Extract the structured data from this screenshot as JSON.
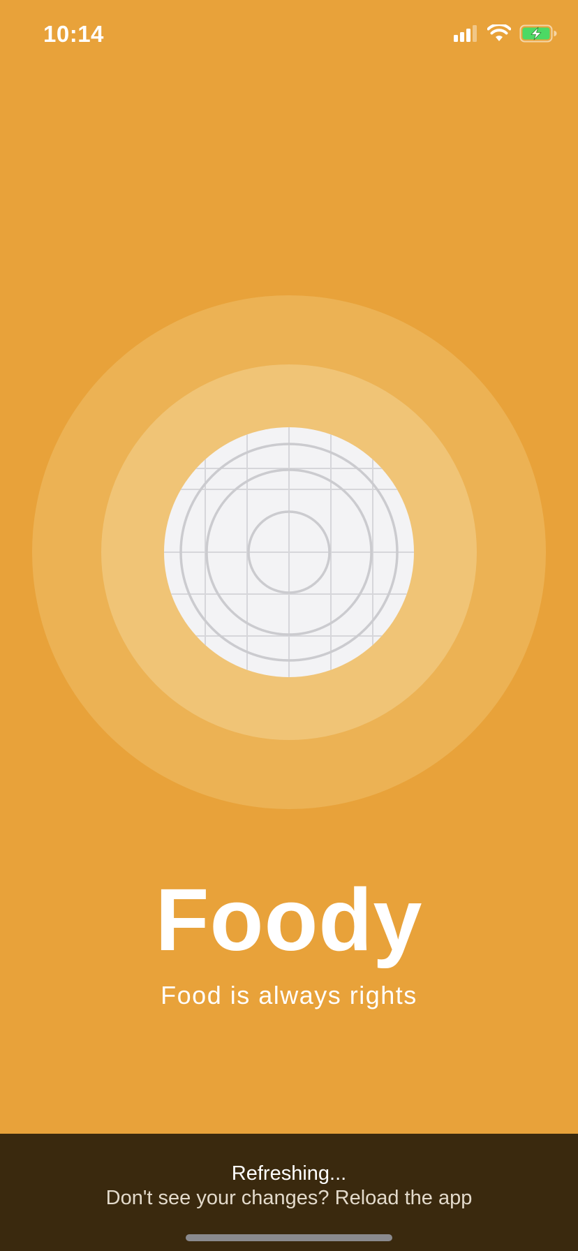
{
  "status_bar": {
    "time": "10:14",
    "icons": [
      "cellular-signal-icon",
      "wifi-icon",
      "battery-charging-icon"
    ]
  },
  "hero": {
    "icon": "plate-grid-illustration-icon"
  },
  "brand": {
    "title": "Foody",
    "tagline": "Food is always rights"
  },
  "refresh_banner": {
    "title": "Refreshing...",
    "subtitle": "Don't see your changes? Reload the app"
  },
  "colors": {
    "background": "#E8A23A",
    "ring_outer": "#ECB254",
    "ring_inner": "#F0C476",
    "plate": "#F3F3F5",
    "plate_lines": "#D0D0D4",
    "banner": "#3A290E",
    "battery_fill": "#4CD964"
  }
}
